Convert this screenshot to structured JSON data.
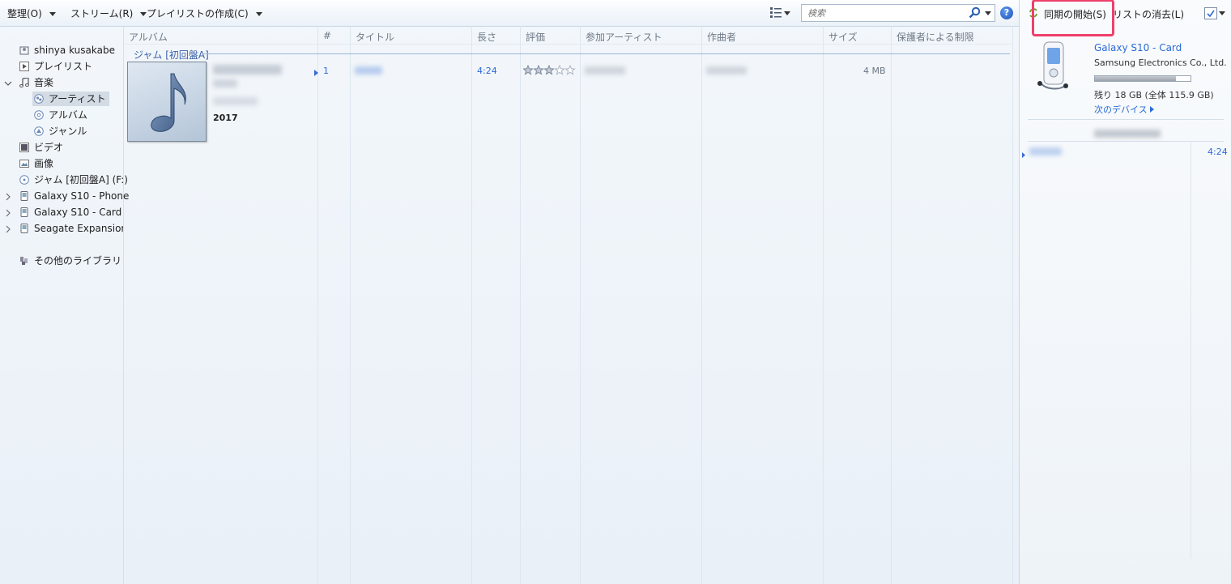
{
  "toolbar": {
    "organize": "整理(O)",
    "stream": "ストリーム(R)",
    "create_playlist": "プレイリストの作成(C)",
    "search_placeholder": "検索"
  },
  "nav": {
    "user": "shinya kusakabe",
    "playlists": "プレイリスト",
    "music": "音楽",
    "artist": "アーティスト",
    "album": "アルバム",
    "genre": "ジャンル",
    "video": "ビデオ",
    "pictures": "画像",
    "disc": "ジャム [初回盤A] (F:)",
    "phone": "Galaxy S10 - Phone",
    "card": "Galaxy S10 - Card",
    "seagate": "Seagate Expansion D",
    "other_libraries": "その他のライブラリ"
  },
  "columns": [
    "アルバム",
    "#",
    "タイトル",
    "長さ",
    "評価",
    "参加アーティスト",
    "作曲者",
    "サイズ",
    "保護者による制限"
  ],
  "album": {
    "group": "ジャム [初回盤A]",
    "year": "2017",
    "track_no": "1",
    "length": "4:24",
    "size": "4 MB",
    "rating": 3
  },
  "sync": {
    "start_label": "同期の開始(S)",
    "clear_label": "リストの消去(L)",
    "device_name": "Galaxy S10 - Card",
    "manufacturer": "Samsung Electronics Co., Ltd.",
    "capacity": "残り 18 GB (全体 115.9 GB)",
    "next_device": "次のデバイス",
    "used_fraction": 0.85,
    "list_item_length": "4:24"
  },
  "colors": {
    "accent": "#2a6ad6",
    "highlight": "#ef3f6b"
  }
}
